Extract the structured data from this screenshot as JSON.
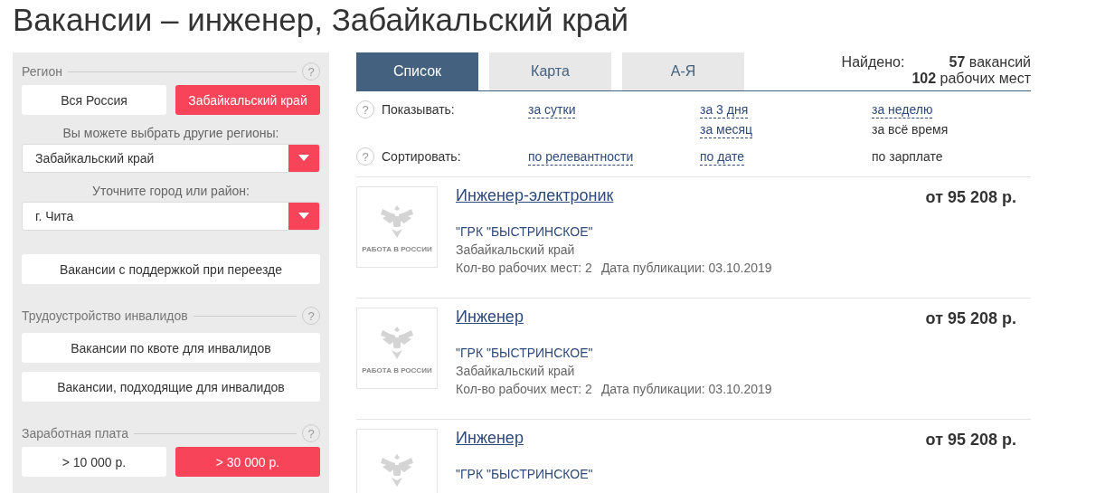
{
  "page_title": "Вакансии – инженер, Забайкальский край",
  "sidebar": {
    "sections": [
      {
        "title": "Регион",
        "help": "?",
        "items": [
          {
            "kind": "toggles",
            "options": [
              {
                "label": "Вся Россия",
                "selected": false
              },
              {
                "label": "Забайкальский край",
                "selected": true
              }
            ]
          },
          {
            "kind": "select",
            "caption": "Вы можете выбрать другие регионы:",
            "value": "Забайкальский край"
          },
          {
            "kind": "select",
            "caption": "Уточните город или район:",
            "value": "г. Чита"
          },
          {
            "kind": "button",
            "label": "Вакансии с поддержкой при переезде"
          }
        ]
      },
      {
        "title": "Трудоустройство инвалидов",
        "help": "?",
        "items": [
          {
            "kind": "button",
            "label": "Вакансии по квоте для инвалидов"
          },
          {
            "kind": "button",
            "label": "Вакансии, подходящие для инвалидов"
          }
        ]
      },
      {
        "title": "Заработная плата",
        "help": "?",
        "items": [
          {
            "kind": "toggles",
            "options": [
              {
                "label": "> 10 000 р.",
                "selected": false
              },
              {
                "label": "> 30 000 р.",
                "selected": true
              }
            ]
          }
        ]
      }
    ]
  },
  "tabs": [
    {
      "label": "Список",
      "selected": true
    },
    {
      "label": "Карта",
      "selected": false
    },
    {
      "label": "А-Я",
      "selected": false
    }
  ],
  "found": {
    "label": "Найдено:",
    "lines": [
      "**57** вакансий",
      "**102** рабочих мест"
    ]
  },
  "filters": [
    {
      "help": "?",
      "label": "Показывать:",
      "columns": [
        [
          {
            "label": "за сутки",
            "selected": false
          }
        ],
        [
          {
            "label": "за 3 дня",
            "selected": false
          },
          {
            "label": "за месяц",
            "selected": false
          }
        ],
        [
          {
            "label": "за неделю",
            "selected": false
          },
          {
            "label": "за всё время",
            "selected": true
          }
        ]
      ]
    },
    {
      "help": "?",
      "label": "Сортировать:",
      "columns": [
        [
          {
            "label": "по релевантности",
            "selected": false
          }
        ],
        [
          {
            "label": "по дате",
            "selected": false
          }
        ],
        [
          {
            "label": "по зарплате",
            "selected": true
          }
        ]
      ]
    }
  ],
  "vacancies": [
    {
      "title": "Инженер-электроник",
      "salary": "от 95 208 р.",
      "employer": "\"ГРК \"БЫСТРИНСКОЕ\"",
      "region": "Забайкальский край",
      "workplaces": "Кол-во рабочих мест: 2",
      "date": "Дата публикации: 03.10.2019",
      "logo_text": "РАБОТА В РОССИИ"
    },
    {
      "title": "Инженер",
      "salary": "от 95 208 р.",
      "employer": "\"ГРК \"БЫСТРИНСКОЕ\"",
      "region": "Забайкальский край",
      "workplaces": "Кол-во рабочих мест: 2",
      "date": "Дата публикации: 03.10.2019",
      "logo_text": "РАБОТА В РОССИИ"
    },
    {
      "title": "Инженер",
      "salary": "от 95 208 р.",
      "employer": "\"ГРК \"БЫСТРИНСКОЕ\""
    }
  ]
}
